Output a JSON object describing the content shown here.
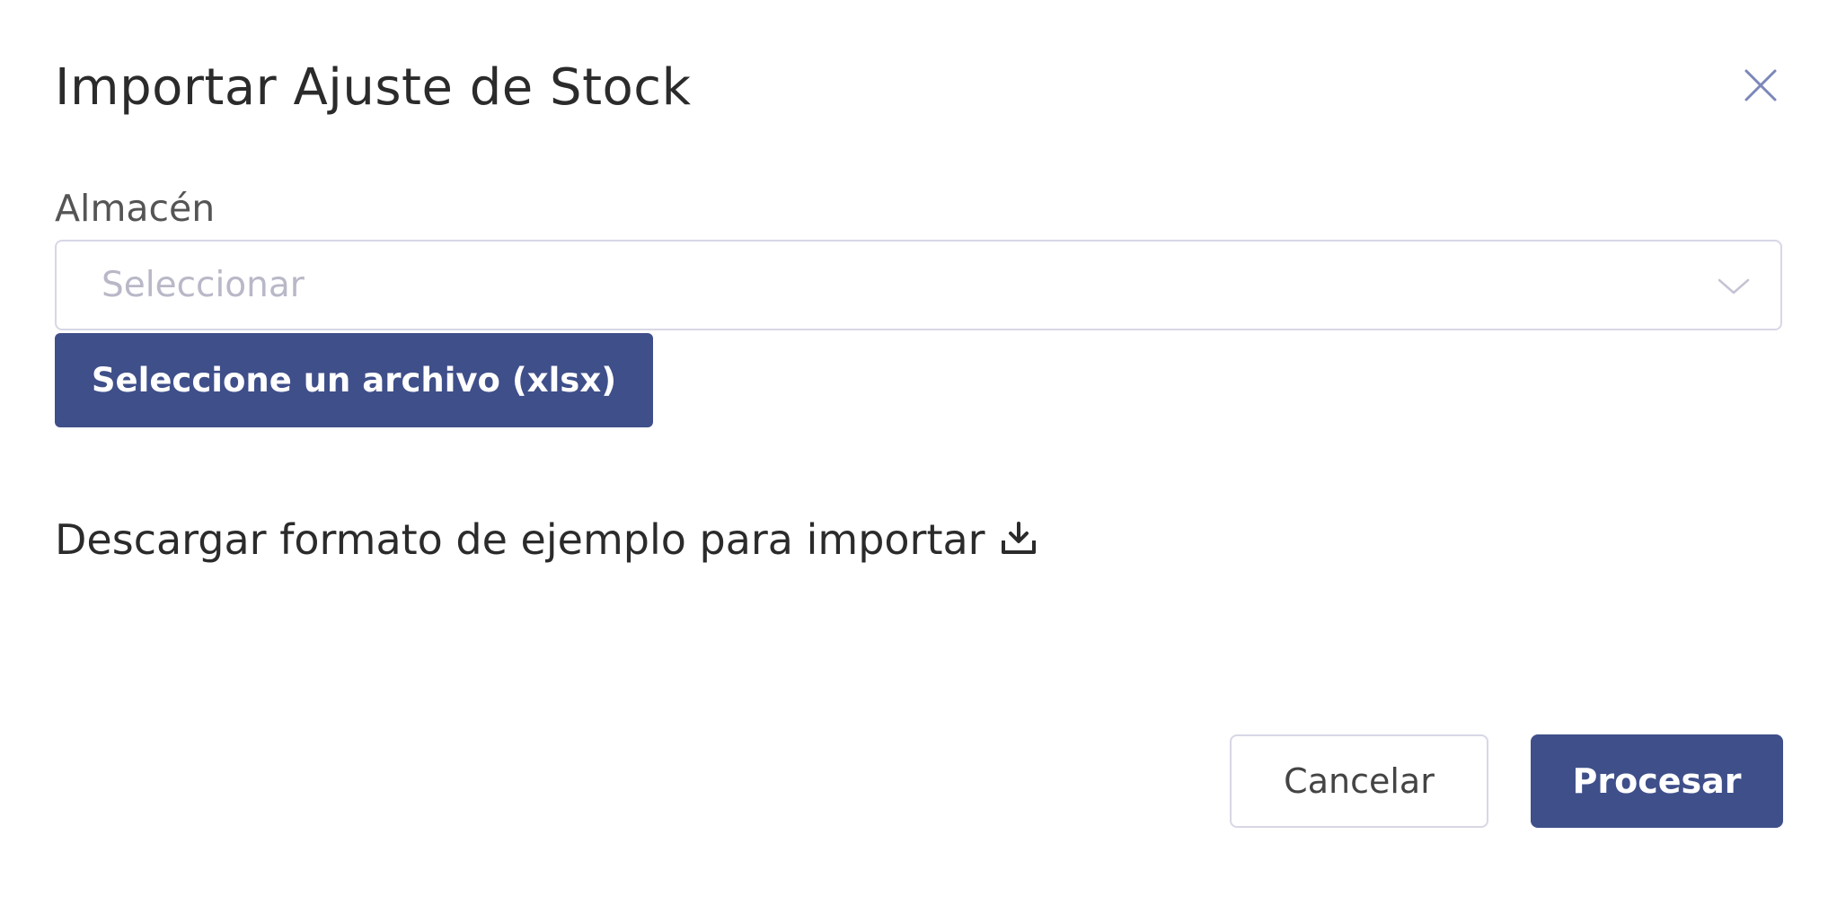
{
  "modal": {
    "title": "Importar Ajuste de Stock",
    "close_icon": "close-icon"
  },
  "warehouse": {
    "label": "Almacén",
    "placeholder": "Seleccionar",
    "chevron_icon": "chevron-down-icon"
  },
  "file_upload": {
    "label": "Seleccione un archivo (xlsx)"
  },
  "download_template": {
    "label": "Descargar formato de ejemplo para importar",
    "icon": "download-icon"
  },
  "footer": {
    "cancel_label": "Cancelar",
    "process_label": "Procesar"
  },
  "colors": {
    "primary": "#3f4f8a",
    "border": "#d7d7e6",
    "placeholder": "#b8b8c8",
    "close_icon": "#7b87b8"
  }
}
